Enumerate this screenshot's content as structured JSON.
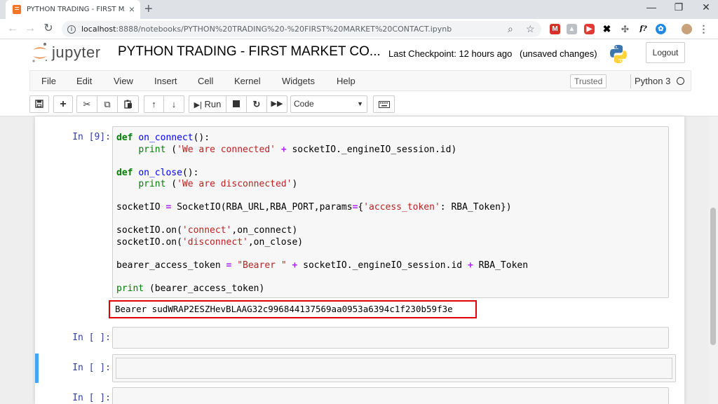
{
  "browser": {
    "tab_title": "PYTHON TRADING - FIRST MARKET CONTACT",
    "tab_close": "×",
    "new_tab": "+",
    "url_host": "localhost",
    "url_path": ":8888/notebooks/PYTHON%20TRADING%20-%20FIRST%20MARKET%20CONTACT.ipynb",
    "window_controls": [
      "—",
      "❐",
      "✕"
    ]
  },
  "jupyter": {
    "wordmark": "jupyter",
    "notebook_title": "PYTHON TRADING - FIRST MARKET CO...",
    "checkpoint": "Last Checkpoint: 12 hours ago",
    "save_status": "(unsaved changes)",
    "logout_label": "Logout",
    "menu": [
      "File",
      "Edit",
      "View",
      "Insert",
      "Cell",
      "Kernel",
      "Widgets",
      "Help"
    ],
    "trusted_label": "Trusted",
    "kernel_name": "Python 3",
    "toolbar": {
      "run_label": "Run",
      "cell_type": "Code"
    }
  },
  "cells": [
    {
      "prompt": "In [9]:",
      "output": "Bearer sudWRAP2ESZHevBLAAG32c996844137569aa0953a6394c1f230b59f3e"
    },
    {
      "prompt": "In [ ]:"
    },
    {
      "prompt": "In [ ]:"
    },
    {
      "prompt": "In [ ]:"
    }
  ],
  "colors": {
    "accent_blue": "#42a5f5",
    "highlight_red": "#e00000",
    "prompt_blue": "#303f9f"
  }
}
